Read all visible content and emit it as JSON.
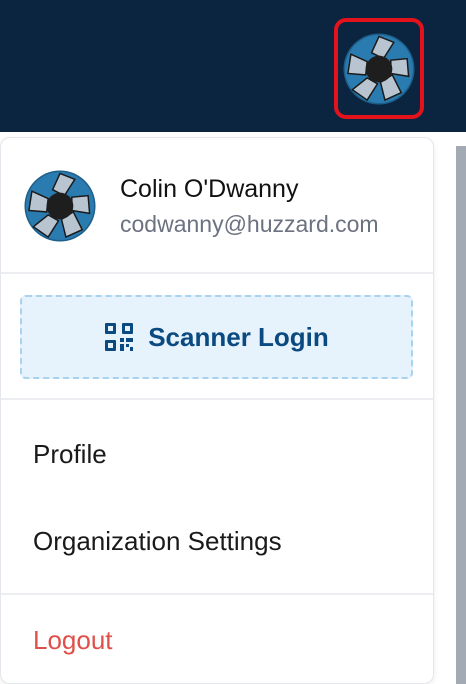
{
  "header": {
    "avatar_icon": "aperture-avatar-icon",
    "avatar_highlight_color": "#e3121b",
    "background_color": "#0b2540"
  },
  "user": {
    "name": "Colin O'Dwanny",
    "email": "codwanny@huzzard.com",
    "avatar_icon": "aperture-avatar-icon"
  },
  "scanner": {
    "label": "Scanner Login",
    "icon": "qr-code-icon",
    "accent_color": "#0b4a80"
  },
  "menu_items": [
    {
      "label": "Profile"
    },
    {
      "label": "Organization Settings"
    }
  ],
  "logout": {
    "label": "Logout",
    "color": "#e0504a"
  }
}
